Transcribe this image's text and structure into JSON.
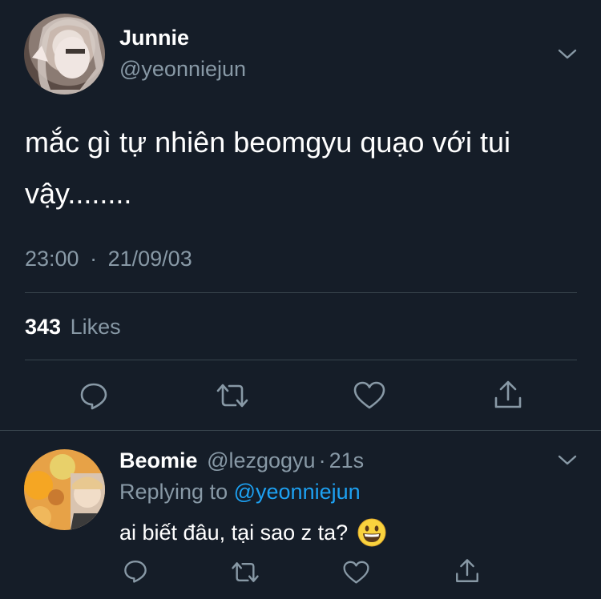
{
  "colors": {
    "background": "#151d28",
    "text": "#ffffff",
    "muted": "#8899a6",
    "link": "#1da1f2",
    "divider": "#38444d"
  },
  "main_tweet": {
    "display_name": "Junnie",
    "handle": "@yeonniejun",
    "text_line1": "mắc gì tự nhiên beomgyu quạo với tui",
    "text_line2": "vậy........",
    "time": "23:00",
    "separator": "·",
    "date": "21/09/03",
    "likes_count": "343",
    "likes_label": "Likes"
  },
  "reply": {
    "display_name": "Beomie",
    "handle": "@lezgogyu",
    "separator": "·",
    "age": "21s",
    "replying_to_label": "Replying to",
    "replying_to_handle": "@yeonniejun",
    "text": "ai biết đâu, tại sao z ta?"
  },
  "icons": {
    "menu": "chevron-down-icon",
    "reply": "reply-icon",
    "retweet": "retweet-icon",
    "like": "heart-icon",
    "share": "share-icon",
    "emoji": "grinning-face-emoji"
  }
}
